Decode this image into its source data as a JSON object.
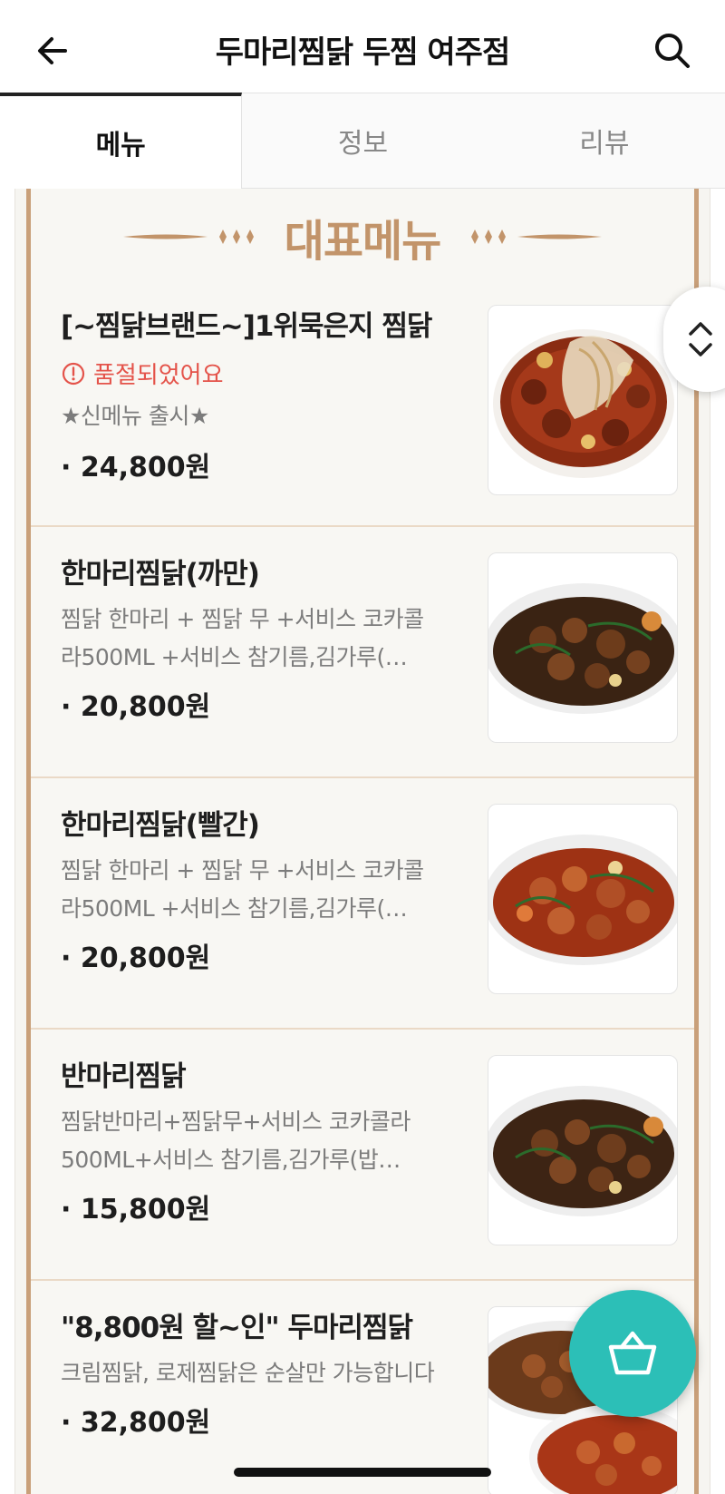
{
  "header": {
    "title": "두마리찜닭 두찜 여주점",
    "back_icon": "arrow-left-icon",
    "search_icon": "search-icon"
  },
  "tabs": [
    {
      "label": "메뉴",
      "active": true
    },
    {
      "label": "정보",
      "active": false
    },
    {
      "label": "리뷰",
      "active": false
    }
  ],
  "board": {
    "title": "대표메뉴",
    "accent_color": "#c2946a"
  },
  "menu_items": [
    {
      "name": "[~찜닭브랜드~]1위묵은지 찜닭",
      "status": "품절되었어요",
      "desc": "★신메뉴 출시★",
      "price": "· 24,800원"
    },
    {
      "name": "한마리찜닭(까만)",
      "desc": "찜닭 한마리 + 찜닭 무 +서비스 코카콜라500ML +서비스 참기름,김가루(…",
      "price": "· 20,800원"
    },
    {
      "name": "한마리찜닭(빨간)",
      "desc": "찜닭 한마리 + 찜닭 무 +서비스 코카콜라500ML +서비스 참기름,김가루(…",
      "price": "· 20,800원"
    },
    {
      "name": "반마리찜닭",
      "desc": "찜닭반마리+찜닭무+서비스 코카콜라500ML+서비스 참기름,김가루(밥…",
      "price": "· 15,800원"
    },
    {
      "name": "\"8,800원 할~인\" 두마리찜닭",
      "desc": "크림찜닭, 로제찜닭은 순살만 가능합니다",
      "price": "· 32,800원"
    }
  ],
  "floating": {
    "scroll_icon": "chevron-up-down-icon",
    "cart_icon": "basket-icon",
    "cart_color": "#2cbfb7"
  }
}
